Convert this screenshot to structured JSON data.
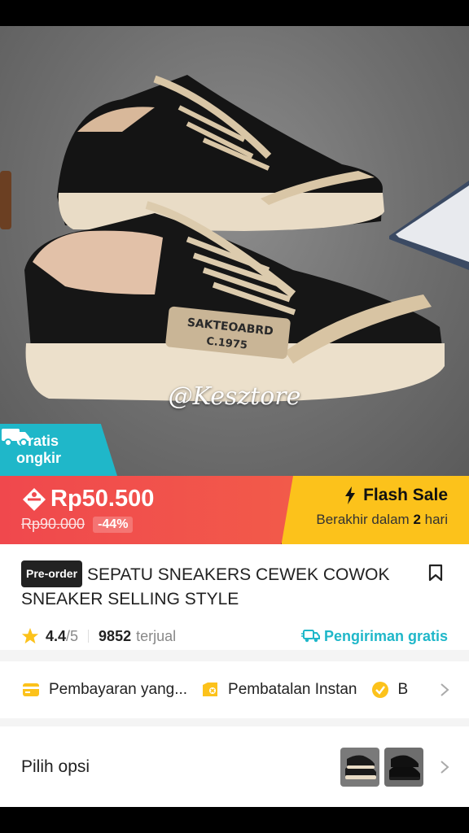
{
  "hero": {
    "watermark": "@Kesztore",
    "shoe_label_line1": "SAKTEOABRD",
    "shoe_label_line2": "C.1975",
    "badge": {
      "line1": "Gratis",
      "line2": "ongkir"
    }
  },
  "price": {
    "current": "Rp50.500",
    "original": "Rp90.000",
    "discount": "-44%"
  },
  "flash_sale": {
    "title": "Flash Sale",
    "ends_prefix": "Berakhir dalam",
    "ends_value": "2",
    "ends_suffix": "hari"
  },
  "product": {
    "preorder_tag": "Pre-order",
    "title": "SEPATU SNEAKERS CEWEK COWOK SNEAKER SELLING STYLE",
    "rating": "4.4",
    "rating_max": "/5",
    "sold_count": "9852",
    "sold_label": "terjual",
    "shipping": "Pengiriman gratis"
  },
  "benefits": [
    {
      "label": "Pembayaran yang...",
      "icon": "card-icon"
    },
    {
      "label": "Pembatalan Instan",
      "icon": "cancel-box-icon"
    },
    {
      "label": "B",
      "icon": "verified-icon"
    }
  ],
  "options": {
    "label": "Pilih opsi"
  },
  "colors": {
    "price_red": "#f0484d",
    "flash_yellow": "#fcc21b",
    "teal": "#1fb7c9"
  }
}
